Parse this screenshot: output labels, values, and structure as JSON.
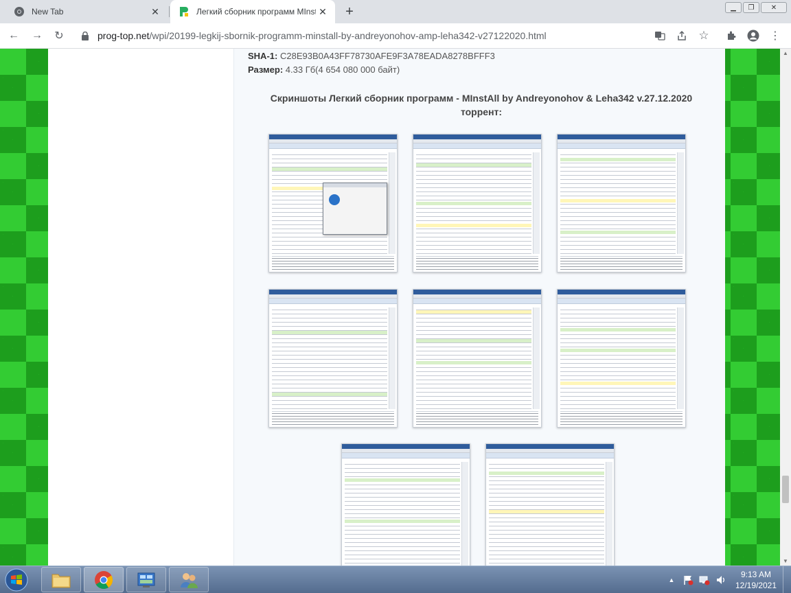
{
  "browser": {
    "tabs": [
      {
        "title": "New Tab",
        "active": false
      },
      {
        "title": "Легкий сборник программ MInstAll",
        "active": true
      }
    ],
    "address": {
      "host": "prog-top.net",
      "path": "/wpi/20199-legkij-sbornik-programm-minstall-by-andreyonohov-amp-leha342-v27122020.html"
    }
  },
  "page": {
    "sha1_label": "SHA-1:",
    "sha1_value": "C28E93B0A43FF78730AFE9F3A78EADA8278BFFF3",
    "size_label": "Размер:",
    "size_value": "4.33 Гб(4 654 080 000 байт)",
    "screenshots_title": "Скриншоты Легкий сборник программ - MInstAll by Andreyonohov & Leha342 v.27.12.2020 торрент:",
    "screenshot_alts": [
      "screenshot-1",
      "screenshot-2",
      "screenshot-3",
      "screenshot-4",
      "screenshot-5",
      "screenshot-6",
      "screenshot-7",
      "screenshot-8"
    ]
  },
  "taskbar": {
    "time": "9:13 AM",
    "date": "12/19/2021"
  },
  "colors": {
    "bg_green": "#33cc33",
    "bg_dark_green": "#1d9e1d",
    "tabstrip": "#dee1e6",
    "taskbar": "#546c8e"
  }
}
